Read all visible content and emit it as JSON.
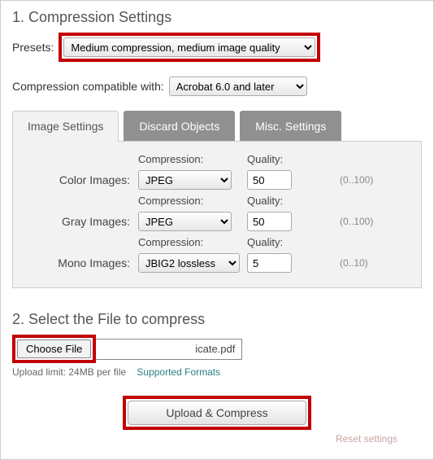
{
  "section1": {
    "title": "1. Compression Settings",
    "presets_label": "Presets:",
    "presets_value": "Medium compression, medium image quality",
    "compat_label": "Compression compatible with:",
    "compat_value": "Acrobat 6.0 and later"
  },
  "tabs": {
    "image": "Image Settings",
    "discard": "Discard Objects",
    "misc": "Misc. Settings"
  },
  "image_settings": {
    "compression_header": "Compression:",
    "quality_header": "Quality:",
    "rows": [
      {
        "label": "Color Images:",
        "compression": "JPEG",
        "quality": "50",
        "range": "(0..100)"
      },
      {
        "label": "Gray Images:",
        "compression": "JPEG",
        "quality": "50",
        "range": "(0..100)"
      },
      {
        "label": "Mono Images:",
        "compression": "JBIG2 lossless",
        "quality": "5",
        "range": "(0..10)"
      }
    ]
  },
  "section2": {
    "title": "2. Select the File to compress",
    "choose_label": "Choose File",
    "filename": "icate.pdf",
    "limit": "Upload limit: 24MB per file",
    "formats": "Supported Formats",
    "upload_btn": "Upload & Compress",
    "reset": "Reset settings"
  }
}
